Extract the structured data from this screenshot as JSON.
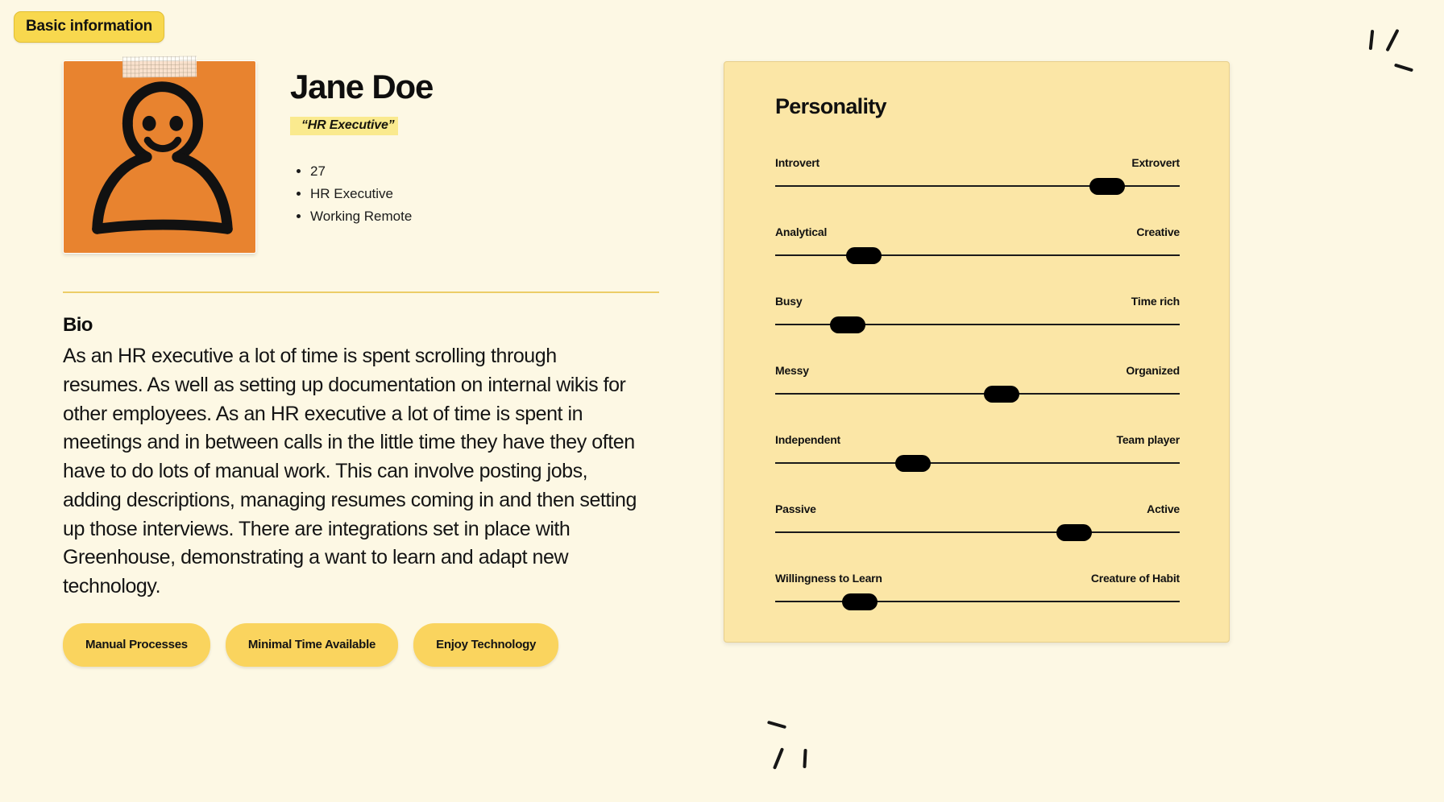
{
  "badge": {
    "label": "Basic information"
  },
  "profile": {
    "avatar_icon": "person-avatar-illustration",
    "name": "Jane Doe",
    "quote": "“HR Executive”",
    "facts": [
      "27",
      "HR Executive",
      "Working Remote"
    ]
  },
  "bio": {
    "title": "Bio",
    "text": "As an HR executive a lot of time is spent scrolling through resumes. As well as setting up documentation on internal wikis for other employees. As an HR executive a lot of time is spent in meetings and in between calls in the little time they have they often have to do lots of manual work. This can involve posting jobs, adding descriptions, managing resumes coming in and then setting up those interviews. There are integrations set in place with Greenhouse, demonstrating a want to learn and adapt new technology."
  },
  "tags": [
    {
      "label": "Manual Processes"
    },
    {
      "label": "Minimal Time Available"
    },
    {
      "label": "Enjoy Technology"
    }
  ],
  "personality": {
    "title": "Personality",
    "sliders": [
      {
        "left_label": "Introvert",
        "right_label": "Extrovert",
        "value": 82
      },
      {
        "left_label": "Analytical",
        "right_label": "Creative",
        "value": 22
      },
      {
        "left_label": "Busy",
        "right_label": "Time rich",
        "value": 18
      },
      {
        "left_label": "Messy",
        "right_label": "Organized",
        "value": 56
      },
      {
        "left_label": "Independent",
        "right_label": "Team player",
        "value": 34
      },
      {
        "left_label": "Passive",
        "right_label": "Active",
        "value": 74
      },
      {
        "left_label": "Willingness to Learn",
        "right_label": "Creature of Habit",
        "value": 21
      }
    ]
  },
  "colors": {
    "page_background": "#fdf8e4",
    "panel_background": "#fbe6a6",
    "badge_yellow": "#f8d84e",
    "pill_yellow": "#fad45e",
    "highlight_yellow": "#faea8e",
    "avatar_orange": "#e8832f",
    "ink": "#111111"
  }
}
